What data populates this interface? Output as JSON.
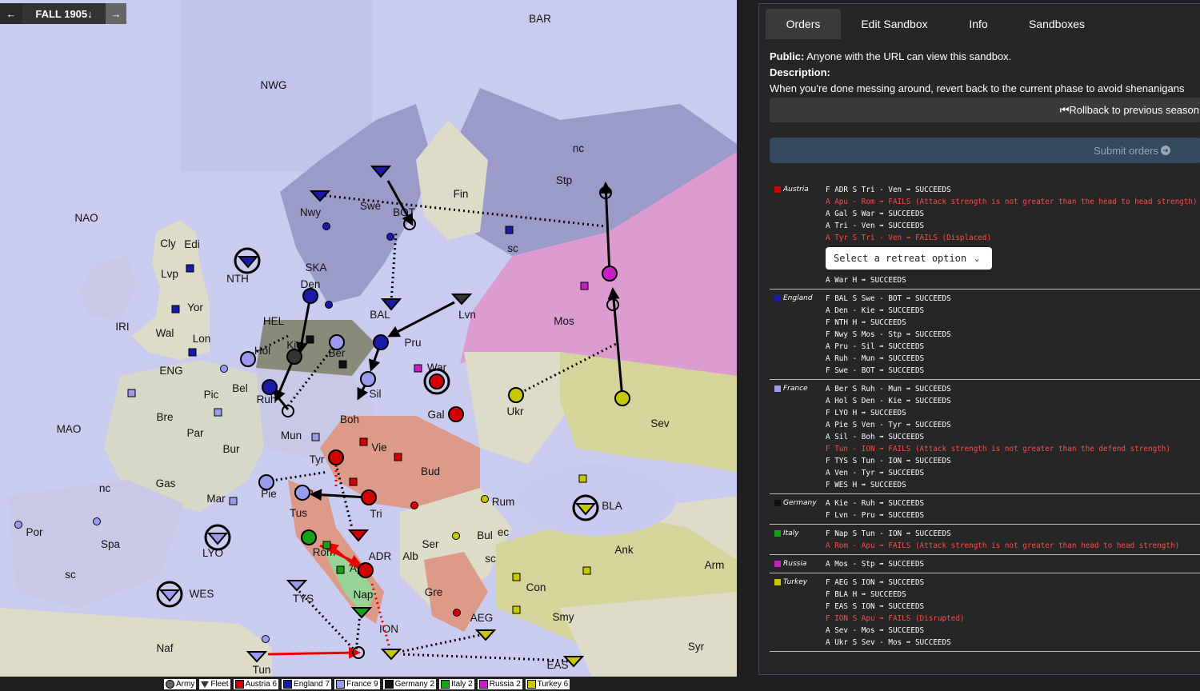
{
  "phase": {
    "name": "FALL 1905",
    "prev_icon": "arrow-left-icon",
    "next_icon": "arrow-right-icon",
    "down_icon": "arrow-down-icon"
  },
  "colors": {
    "austria": "#d20000",
    "england": "#1a1aa8",
    "france": "#9b9bee",
    "germany": "#111111",
    "italy": "#19a019",
    "russia": "#c81ec8",
    "turkey": "#c8c800"
  },
  "map": {
    "labels": [
      "BAR",
      "NWG",
      "NAO",
      "nc",
      "Stp",
      "Fin",
      "Nwy",
      "Swe",
      "BOT",
      "sc",
      "Cly",
      "Edi",
      "Lvp",
      "Yor",
      "NTH",
      "SKA",
      "Den",
      "IRI",
      "Wal",
      "Lon",
      "HEL",
      "BAL",
      "Lvn",
      "Mos",
      "Kie",
      "Hol",
      "Ber",
      "Pru",
      "ENG",
      "Bel",
      "Ruh",
      "Sil",
      "War",
      "Pic",
      "Gal",
      "Ukr",
      "Sev",
      "Bre",
      "Par",
      "Boh",
      "MAO",
      "Mun",
      "Vie",
      "Bur",
      "Tyr",
      "Bud",
      "Gas",
      "Pie",
      "Ven",
      "Rum",
      "Tri",
      "Mar",
      "Tus",
      "BLA",
      "Por",
      "Spa",
      "nc",
      "Bul",
      "ec",
      "LYO",
      "Rom",
      "ADR",
      "Alb",
      "Ser",
      "sc",
      "Ank",
      "Arm",
      "sc",
      "WES",
      "TYS",
      "Apu",
      "Nap",
      "Gre",
      "Con",
      "Smy",
      "AEG",
      "ION",
      "Naf",
      "Tun",
      "EAS",
      "Syr"
    ]
  },
  "legend": [
    {
      "label": "Army",
      "icon": "army-circle-icon"
    },
    {
      "label": "Fleet",
      "icon": "fleet-triangle-icon"
    },
    {
      "label": "Austria 6",
      "color": "#d20000"
    },
    {
      "label": "England 7",
      "color": "#1a1aa8"
    },
    {
      "label": "France 9",
      "color": "#9b9bee"
    },
    {
      "label": "Germany 2",
      "color": "#111111"
    },
    {
      "label": "Italy 2",
      "color": "#19a019"
    },
    {
      "label": "Russia 2",
      "color": "#c81ec8"
    },
    {
      "label": "Turkey 6",
      "color": "#c8c800"
    }
  ],
  "tabs": [
    "Orders",
    "Edit Sandbox",
    "Info",
    "Sandboxes"
  ],
  "description": {
    "public_label": "Public:",
    "public_text": "Anyone with the URL can view this sandbox.",
    "desc_label": "Description:",
    "desc_text": "When you're done messing around, revert back to the current phase to avoid shenanigans"
  },
  "rollback_label": "Rollback to previous season",
  "submit_label": "Submit orders",
  "retreat_placeholder": "Select a retreat option",
  "nations": [
    {
      "name": "Austria",
      "color": "#d20000",
      "orders": [
        {
          "text": "F ADR S Tri - Ven ➡ SUCCEEDS",
          "fail": false
        },
        {
          "text": "A Apu - Rom ➡ FAILS (Attack strength is not greater than the head to head strength)",
          "fail": true
        },
        {
          "text": "A Gal S War ➡ SUCCEEDS",
          "fail": false
        },
        {
          "text": "A Tri - Ven ➡ SUCCEEDS",
          "fail": false
        },
        {
          "text": "A Tyr S Tri - Ven ➡ FAILS (Displaced)",
          "fail": true
        },
        {
          "text": "A War H ➡ SUCCEEDS",
          "fail": false
        }
      ]
    },
    {
      "name": "England",
      "color": "#1a1aa8",
      "orders": [
        {
          "text": "F BAL S Swe - BOT ➡ SUCCEEDS",
          "fail": false
        },
        {
          "text": "A Den - Kie ➡ SUCCEEDS",
          "fail": false
        },
        {
          "text": "F NTH H ➡ SUCCEEDS",
          "fail": false
        },
        {
          "text": "F Nwy S Mos - Stp ➡ SUCCEEDS",
          "fail": false
        },
        {
          "text": "A Pru - Sil ➡ SUCCEEDS",
          "fail": false
        },
        {
          "text": "A Ruh - Mun ➡ SUCCEEDS",
          "fail": false
        },
        {
          "text": "F Swe - BOT ➡ SUCCEEDS",
          "fail": false
        }
      ]
    },
    {
      "name": "France",
      "color": "#9b9bee",
      "orders": [
        {
          "text": "A Ber S Ruh - Mun ➡ SUCCEEDS",
          "fail": false
        },
        {
          "text": "A Hol S Den - Kie ➡ SUCCEEDS",
          "fail": false
        },
        {
          "text": "F LYO H ➡ SUCCEEDS",
          "fail": false
        },
        {
          "text": "A Pie S Ven - Tyr ➡ SUCCEEDS",
          "fail": false
        },
        {
          "text": "A Sil - Boh ➡ SUCCEEDS",
          "fail": false
        },
        {
          "text": "F Tun - ION ➡ FAILS (Attack strength is not greater than the defend strength)",
          "fail": true
        },
        {
          "text": "F TYS S Tun - ION ➡ SUCCEEDS",
          "fail": false
        },
        {
          "text": "A Ven - Tyr ➡ SUCCEEDS",
          "fail": false
        },
        {
          "text": "F WES H ➡ SUCCEEDS",
          "fail": false
        }
      ]
    },
    {
      "name": "Germany",
      "color": "#111111",
      "orders": [
        {
          "text": "A Kie - Ruh ➡ SUCCEEDS",
          "fail": false
        },
        {
          "text": "F Lvn - Pru ➡ SUCCEEDS",
          "fail": false
        }
      ]
    },
    {
      "name": "Italy",
      "color": "#19a019",
      "orders": [
        {
          "text": "F Nap S Tun - ION ➡ SUCCEEDS",
          "fail": false
        },
        {
          "text": "A Rom - Apu ➡ FAILS (Attack strength is not greater than head to head strength)",
          "fail": true
        }
      ]
    },
    {
      "name": "Russia",
      "color": "#c81ec8",
      "orders": [
        {
          "text": "A Mos - Stp ➡ SUCCEEDS",
          "fail": false
        }
      ]
    },
    {
      "name": "Turkey",
      "color": "#c8c800",
      "orders": [
        {
          "text": "F AEG S ION ➡ SUCCEEDS",
          "fail": false
        },
        {
          "text": "F BLA H ➡ SUCCEEDS",
          "fail": false
        },
        {
          "text": "F EAS S ION ➡ SUCCEEDS",
          "fail": false
        },
        {
          "text": "F ION S Apu ➡ FAILS (Disrupted)",
          "fail": true
        },
        {
          "text": "A Sev - Mos ➡ SUCCEEDS",
          "fail": false
        },
        {
          "text": "A Ukr S Sev - Mos ➡ SUCCEEDS",
          "fail": false
        }
      ]
    }
  ]
}
